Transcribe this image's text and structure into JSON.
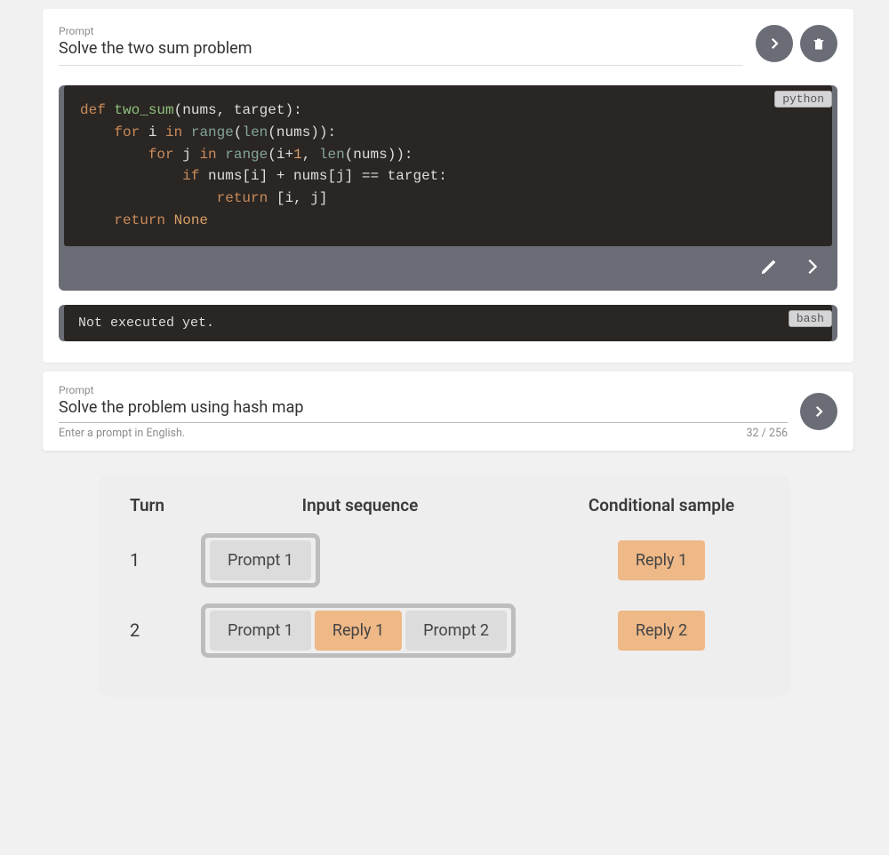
{
  "prompt1": {
    "label": "Prompt",
    "text": "Solve the two sum problem"
  },
  "code_block": {
    "language": "python",
    "lines": [
      "def two_sum(nums, target):",
      "    for i in range(len(nums)):",
      "        for j in range(i+1, len(nums)):",
      "            if nums[i] + nums[j] == target:",
      "                return [i, j]",
      "    return None"
    ]
  },
  "bash_block": {
    "language": "bash",
    "text": "Not executed yet."
  },
  "prompt2": {
    "label": "Prompt",
    "text": "Solve the problem using hash map",
    "helper": "Enter a prompt in English.",
    "counter": "32 / 256"
  },
  "table": {
    "headers": {
      "turn": "Turn",
      "input_seq": "Input sequence",
      "cond_sample": "Conditional sample"
    },
    "rows": [
      {
        "turn": "1",
        "input": [
          "Prompt 1"
        ],
        "sample": "Reply 1"
      },
      {
        "turn": "2",
        "input": [
          "Prompt 1",
          "Reply 1",
          "Prompt 2"
        ],
        "sample": "Reply 2"
      }
    ]
  }
}
